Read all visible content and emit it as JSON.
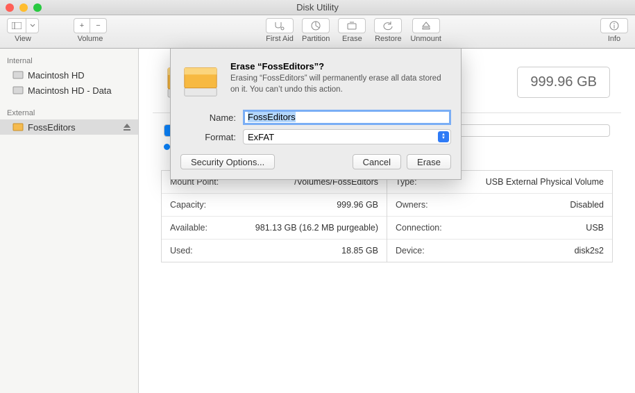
{
  "window": {
    "title": "Disk Utility"
  },
  "toolbar": {
    "view_label": "View",
    "volume_label": "Volume",
    "first_aid": "First Aid",
    "partition": "Partition",
    "erase": "Erase",
    "restore": "Restore",
    "unmount": "Unmount",
    "info": "Info"
  },
  "sidebar": {
    "internal_header": "Internal",
    "internal": [
      {
        "label": "Macintosh HD"
      },
      {
        "label": "Macintosh HD - Data"
      }
    ],
    "external_header": "External",
    "external": [
      {
        "label": "FossEditors",
        "selected": true
      }
    ]
  },
  "header": {
    "capacity_badge": "999.96 GB"
  },
  "details": {
    "left": [
      {
        "k": "Mount Point:",
        "v": "/Volumes/FossEditors"
      },
      {
        "k": "Capacity:",
        "v": "999.96 GB"
      },
      {
        "k": "Available:",
        "v": "981.13 GB (16.2 MB purgeable)"
      },
      {
        "k": "Used:",
        "v": "18.85 GB"
      }
    ],
    "right": [
      {
        "k": "Type:",
        "v": "USB External Physical Volume"
      },
      {
        "k": "Owners:",
        "v": "Disabled"
      },
      {
        "k": "Connection:",
        "v": "USB"
      },
      {
        "k": "Device:",
        "v": "disk2s2"
      }
    ]
  },
  "dialog": {
    "title": "Erase “FossEditors”?",
    "message": "Erasing “FossEditors” will permanently erase all data stored on it. You can’t undo this action.",
    "name_label": "Name:",
    "name_value": "FossEditors",
    "format_label": "Format:",
    "format_value": "ExFAT",
    "security_options": "Security Options...",
    "cancel": "Cancel",
    "erase": "Erase"
  }
}
